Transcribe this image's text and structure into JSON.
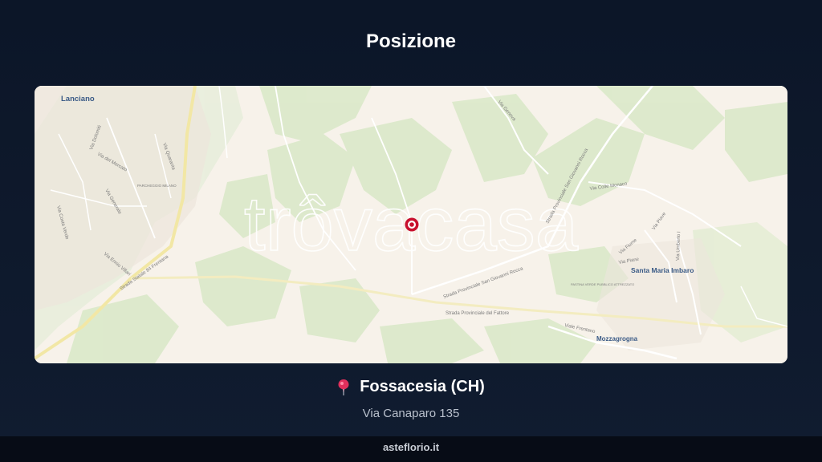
{
  "header": {
    "title": "Posizione"
  },
  "map": {
    "watermark": "trôvacasa",
    "labels": {
      "lanciano": "Lanciano",
      "santa_maria_imbaro": "Santa Maria Imbaro",
      "mozzagrogna": "Mozzagrogna",
      "parcheggio_milano": "PARCHEGGIO MILANO",
      "pastina_verde": "PASTINA VERDE PUBBLICO ATTREZZATO",
      "strada_statale": "Strada Statale 84 Frentana",
      "sp_san_giovanni": "Strada Provinciale San Giovanni Rocca",
      "sp_san_giovanni_2": "Strada Provinciale San Giovanni Rocca",
      "sp_fattore": "Strada Provinciale del Fattore",
      "viale_frentano": "Viale Frentano",
      "via_colle_monaco": "Via Colle Monaco",
      "via_ennio_villari": "Via Ennio Villari",
      "via_dolomiti": "Via Dolomiti",
      "via_del_mercato": "Via del Mercato",
      "via_fiume": "Via Fiume",
      "via_fiume_2": "Via Piave",
      "via_umberto": "Via Umberto I",
      "via_quaranta": "Via Quaranta",
      "via_generale": "Via Generale",
      "via_costa_verde": "Via Costa Verde",
      "via_genova": "Via Genova",
      "via_piane": "Via Piane"
    },
    "colors": {
      "marker": "#c8102e",
      "background": "#f7f2ea",
      "green": "#d9e8c8",
      "road": "#f5eaa8"
    }
  },
  "location": {
    "city": "Fossacesia (CH)",
    "address": "Via Canaparo 135"
  },
  "footer": {
    "brand": "asteflorio.it"
  }
}
